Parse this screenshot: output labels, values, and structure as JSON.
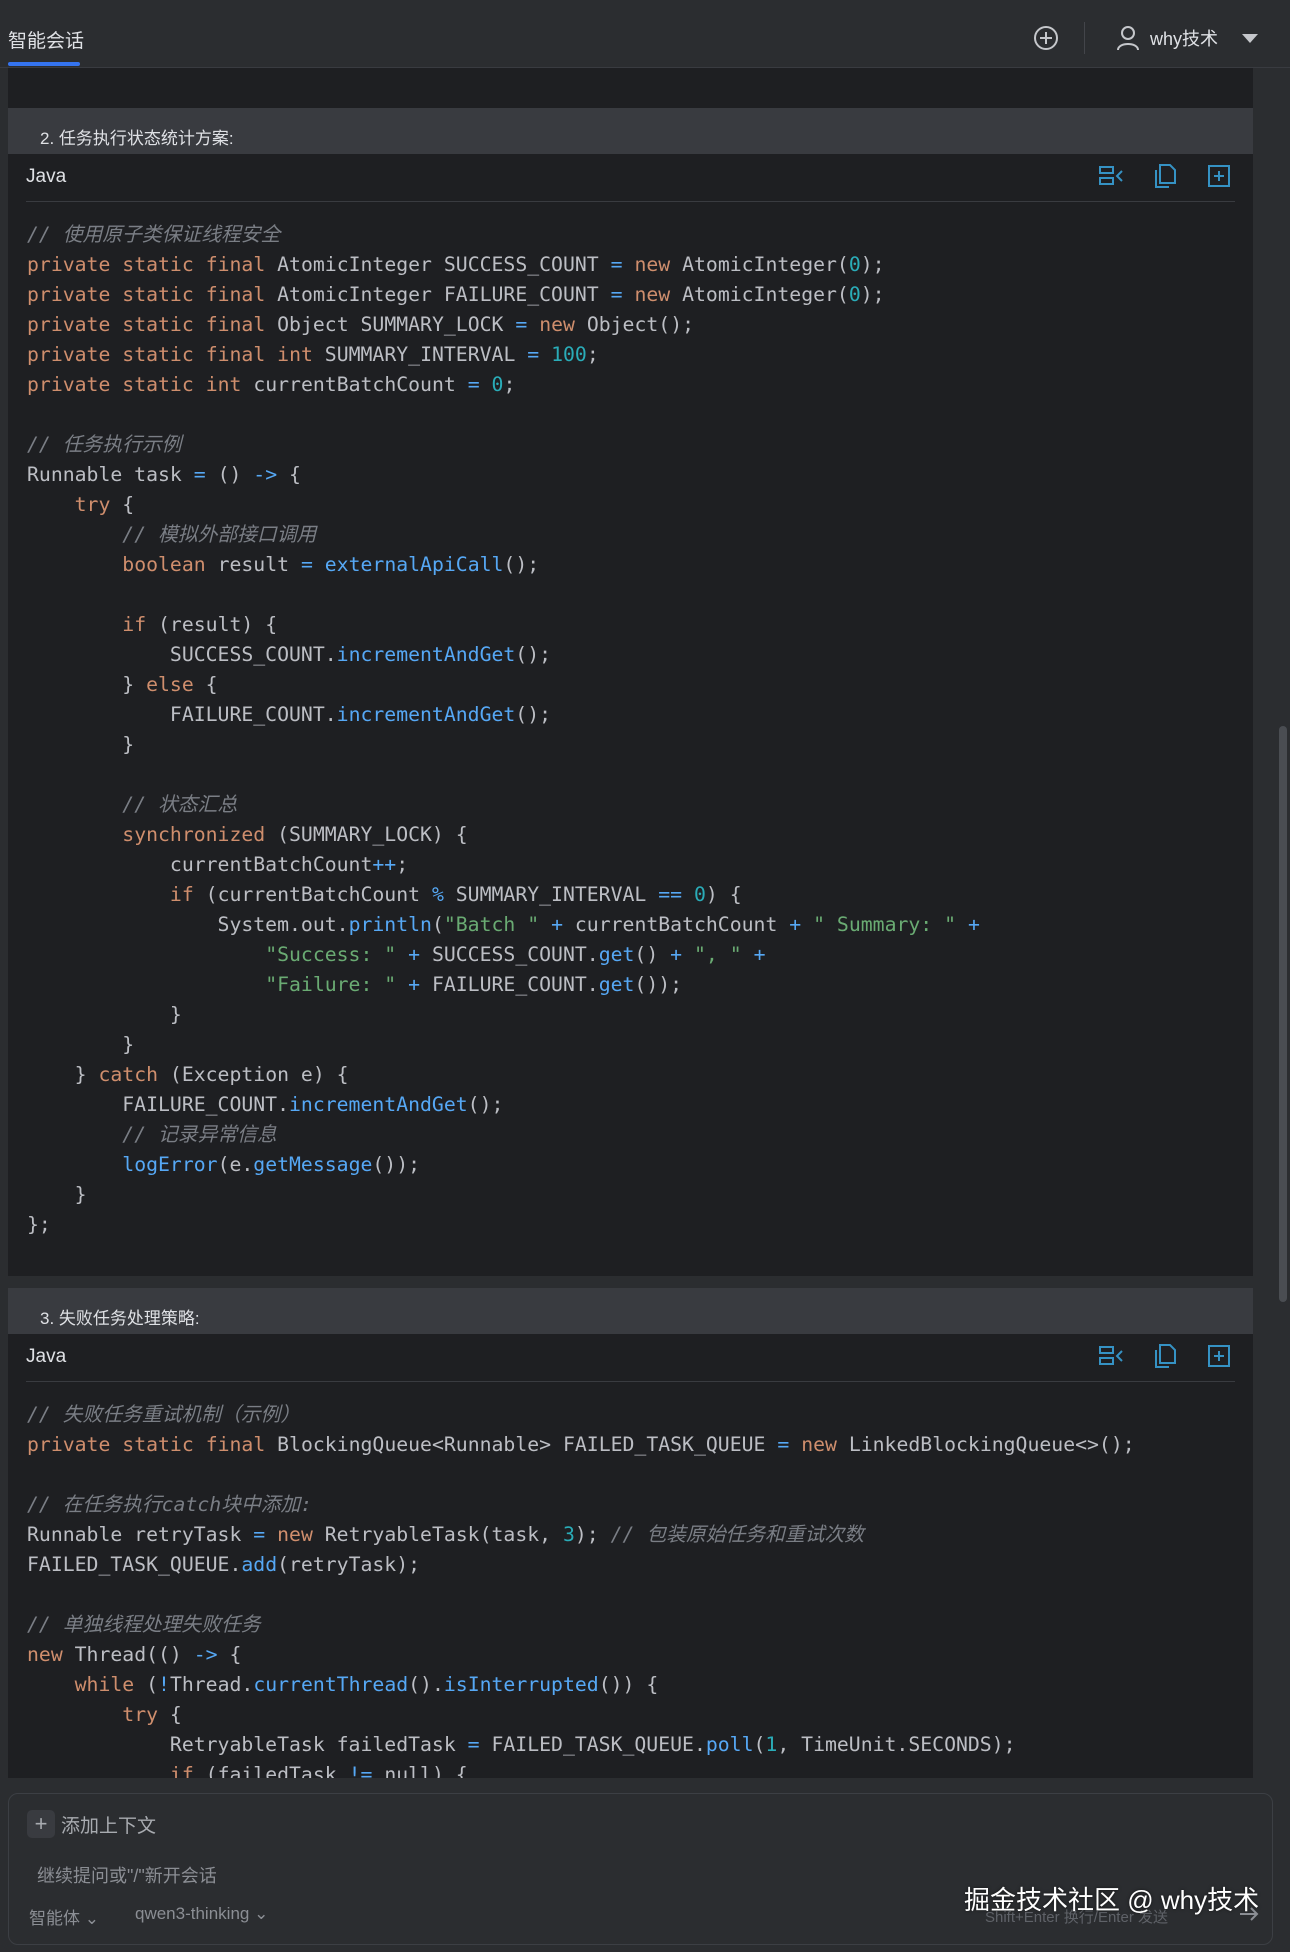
{
  "header": {
    "tab_label": "智能会话",
    "user_name": "why技术",
    "icons": [
      "new-chat-plus-circle",
      "user",
      "dropdown-caret"
    ]
  },
  "sections": [
    {
      "step_title": "2. 任务执行状态统计方案:",
      "language": "Java",
      "toolbar_icons": [
        "insert-at-cursor",
        "copy",
        "new-file"
      ],
      "code_lines": [
        "// 使用原子类保证线程安全",
        "private static final AtomicInteger SUCCESS_COUNT = new AtomicInteger(0);",
        "private static final AtomicInteger FAILURE_COUNT = new AtomicInteger(0);",
        "private static final Object SUMMARY_LOCK = new Object();",
        "private static final int SUMMARY_INTERVAL = 100;",
        "private static int currentBatchCount = 0;",
        "",
        "// 任务执行示例",
        "Runnable task = () -> {",
        "    try {",
        "        // 模拟外部接口调用",
        "        boolean result = externalApiCall();",
        "",
        "        if (result) {",
        "            SUCCESS_COUNT.incrementAndGet();",
        "        } else {",
        "            FAILURE_COUNT.incrementAndGet();",
        "        }",
        "",
        "        // 状态汇总",
        "        synchronized (SUMMARY_LOCK) {",
        "            currentBatchCount++;",
        "            if (currentBatchCount % SUMMARY_INTERVAL == 0) {",
        "                System.out.println(\"Batch \" + currentBatchCount + \" Summary: \" +",
        "                    \"Success: \" + SUCCESS_COUNT.get() + \", \" +",
        "                    \"Failure: \" + FAILURE_COUNT.get());",
        "            }",
        "        }",
        "    } catch (Exception e) {",
        "        FAILURE_COUNT.incrementAndGet();",
        "        // 记录异常信息",
        "        logError(e.getMessage());",
        "    }",
        "};"
      ]
    },
    {
      "step_title": "3. 失败任务处理策略:",
      "language": "Java",
      "toolbar_icons": [
        "insert-at-cursor",
        "copy",
        "new-file"
      ],
      "code_lines": [
        "// 失败任务重试机制（示例）",
        "private static final BlockingQueue<Runnable> FAILED_TASK_QUEUE = new LinkedBlockingQueue<>();",
        "",
        "// 在任务执行catch块中添加:",
        "Runnable retryTask = new RetryableTask(task, 3); // 包装原始任务和重试次数",
        "FAILED_TASK_QUEUE.add(retryTask);",
        "",
        "// 单独线程处理失败任务",
        "new Thread(() -> {",
        "    while (!Thread.currentThread().isInterrupted()) {",
        "        try {",
        "            RetryableTask failedTask = FAILED_TASK_QUEUE.poll(1, TimeUnit.SECONDS);",
        "            if (failedTask != null) {"
      ]
    }
  ],
  "input": {
    "add_context_label": "添加上下文",
    "placeholder": "继续提问或\"/\"新开会话",
    "agent_label": "智能体",
    "model_label": "qwen3-thinking",
    "send_hint": "Shift+Enter 换行/Enter 发送"
  },
  "watermark": "掘金技术社区 @ why技术",
  "colors": {
    "background": "#2b2d30",
    "code_background": "#1e1f22",
    "keyword": "#cf8e6d",
    "number": "#2aacb8",
    "string": "#6aab73",
    "function": "#56a8f5",
    "comment": "#7a7e85",
    "accent": "#3574f0"
  }
}
